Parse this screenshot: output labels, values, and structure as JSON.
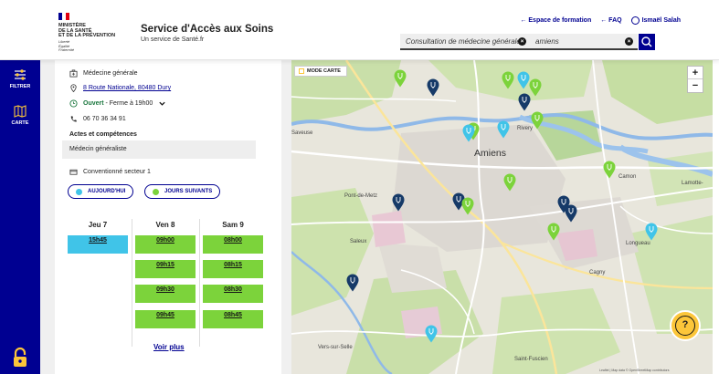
{
  "header": {
    "ministry_lines": [
      "MINISTÈRE",
      "DE LA SANTÉ",
      "ET DE LA PRÉVENTION"
    ],
    "motto_lines": [
      "Liberté",
      "Égalité",
      "Fraternité"
    ],
    "title": "Service d'Accès aux Soins",
    "subtitle": "Un service de Santé.fr",
    "links": {
      "training": "← Espace de formation",
      "faq": "← FAQ",
      "user": "Ismaël Salah"
    },
    "search": {
      "specialty_value": "Consultation de médecine générale",
      "location_value": "amiens"
    }
  },
  "rail": {
    "filter_label": "FILTRER",
    "map_label": "CARTE"
  },
  "detail": {
    "specialty": "Médecine générale",
    "address": "8 Route Nationale, 80480 Dury",
    "status": "Ouvert",
    "hours": " - Ferme à 19h00",
    "phone": "06 70 36 34 91",
    "acts_title": "Actes et compétences",
    "acts_value": "Médecin généraliste",
    "convention": "Conventionné secteur 1",
    "pill_today": "AUJOURD'HUI",
    "pill_next": "JOURS SUIVANTS",
    "days": [
      {
        "label": "Jeu 7",
        "slots": [
          "15h45"
        ]
      },
      {
        "label": "Ven 8",
        "slots": [
          "09h00",
          "09h15",
          "09h30",
          "09h45"
        ]
      },
      {
        "label": "Sam 9",
        "slots": [
          "08h00",
          "08h15",
          "08h30",
          "08h45"
        ]
      }
    ],
    "more": "Voir plus"
  },
  "map": {
    "mode_label": "MODE CARTE",
    "zoom_in": "+",
    "zoom_out": "−",
    "help": "?",
    "places": {
      "amiens": "Amiens",
      "rivery": "Rivery",
      "camon": "Camon",
      "lamotte": "Lamotte-",
      "pont_de_metz": "Pont-de-Metz",
      "saleux": "Saleux",
      "longueau": "Longueau",
      "cagny": "Cagny",
      "vers_sur_selle": "Vers-sur-Selle",
      "saint_fuscien": "Saint-Fuscien",
      "saveuse": "Saveuse"
    },
    "attribution": "Leaflet | Map data © OpenStreetMap contributors",
    "colors": {
      "green_pin": "#7cd33b",
      "blue_pin": "#40c4e8",
      "navy_pin": "#163a68"
    }
  },
  "colors": {
    "primary": "#000091",
    "slot_today": "#40c4e8",
    "slot_next": "#7cd33b",
    "help": "#fcc63a"
  }
}
